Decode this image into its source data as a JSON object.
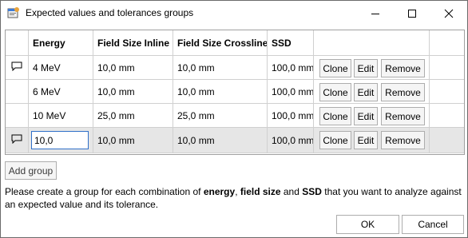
{
  "window": {
    "title": "Expected values and tolerances groups",
    "icon": "app-dialog-icon"
  },
  "grid": {
    "columns": [
      "",
      "Energy",
      "Field Size Inline",
      "Field Size Crossline",
      "SSD",
      "",
      ""
    ],
    "rows": [
      {
        "comment_icon": true,
        "energy": "4 MeV",
        "inline": "10,0 mm",
        "crossline": "10,0 mm",
        "ssd": "100,0 mm"
      },
      {
        "comment_icon": false,
        "energy": "6 MeV",
        "inline": "10,0 mm",
        "crossline": "10,0 mm",
        "ssd": "100,0 mm"
      },
      {
        "comment_icon": false,
        "energy": "10 MeV",
        "inline": "25,0 mm",
        "crossline": "25,0 mm",
        "ssd": "100,0 mm"
      },
      {
        "comment_icon": true,
        "energy_input": "10,0",
        "inline": "10,0 mm",
        "crossline": "10,0 mm",
        "ssd": "100,0 mm",
        "editing": true
      }
    ],
    "actions": {
      "clone": "Clone",
      "edit": "Edit",
      "remove": "Remove"
    }
  },
  "add_group": "Add group",
  "help": {
    "part1": "Please create a group for each combination of ",
    "k1": "energy",
    "sep1": ", ",
    "k2": "field size",
    "sep2": " and ",
    "k3": "SSD",
    "part2": " that you want to analyze against an expected value and its tolerance."
  },
  "footer": {
    "ok": "OK",
    "cancel": "Cancel"
  },
  "colors": {
    "selected_row": "#e6e6e6",
    "input_border": "#2f6fc8"
  }
}
